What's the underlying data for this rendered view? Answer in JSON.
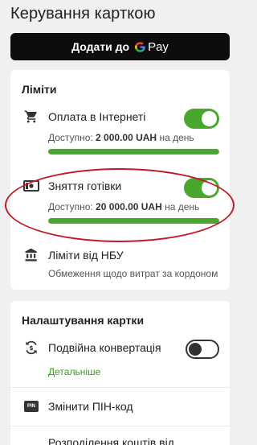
{
  "header": {
    "title": "Керування карткою"
  },
  "gpay": {
    "add_label": "Додати до",
    "pay_label": "Pay"
  },
  "limits": {
    "title": "Ліміти",
    "online": {
      "label": "Оплата в Інтернеті",
      "available_prefix": "Доступно:",
      "amount": "2 000.00 UAH",
      "suffix": "на день",
      "enabled": true,
      "available_fraction": 1.0
    },
    "cash": {
      "label": "Зняття готівки",
      "available_prefix": "Доступно:",
      "amount": "20 000.00 UAH",
      "suffix": "на день",
      "enabled": true,
      "available_fraction": 1.0
    },
    "nbu": {
      "label": "Ліміти від НБУ",
      "description": "Обмеження щодо витрат за кордоном"
    }
  },
  "settings": {
    "title": "Налаштування картки",
    "double_conversion": {
      "label": "Подвійна конвертація",
      "details": "Детальніше",
      "enabled": false
    },
    "pin": {
      "label": "Змінити ПІН-код",
      "icon_text": "PIN"
    },
    "distribution": {
      "label": "Розподілення коштів від"
    }
  },
  "colors": {
    "accent_green": "#4aa72e",
    "highlight_red": "#c21a2b",
    "button_black": "#0d0d0d"
  },
  "icons": {
    "online": "shopping-cart-icon",
    "cash": "cash-icon",
    "nbu": "bank-icon",
    "conversion": "currency-exchange-icon",
    "pin": "pin-icon",
    "gpay": "google-g-icon"
  }
}
